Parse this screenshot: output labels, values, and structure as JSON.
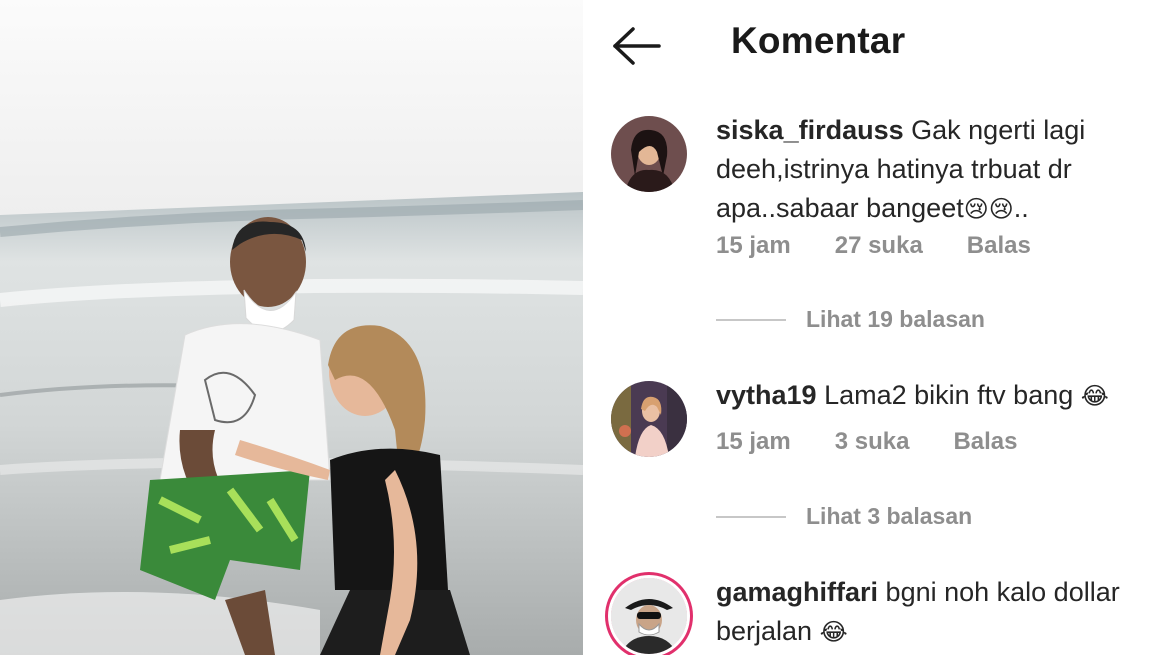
{
  "header": {
    "back_icon": "arrow-left-icon",
    "title": "Komentar"
  },
  "comments": [
    {
      "username": "siska_firdauss",
      "text": "Gak ngerti lagi deeh,istrinya hatinya trbuat dr apa..sabaar bangeet",
      "emoji": "😢😢",
      "suffix": "..",
      "time": "15 jam",
      "likes": "27 suka",
      "reply_label": "Balas",
      "view_replies": "Lihat 19 balasan"
    },
    {
      "username": "vytha19",
      "text": "Lama2 bikin ftv bang",
      "emoji": "😂",
      "suffix": "",
      "time": "15 jam",
      "likes": "3 suka",
      "reply_label": "Balas",
      "view_replies": "Lihat 3 balasan"
    },
    {
      "username": "gamaghiffari",
      "text": "bgni noh kalo dollar berjalan",
      "emoji": "😂",
      "suffix": ""
    }
  ],
  "colors": {
    "username": "#262626",
    "meta": "#8e8e8e",
    "story_ring": "#e1306c"
  }
}
